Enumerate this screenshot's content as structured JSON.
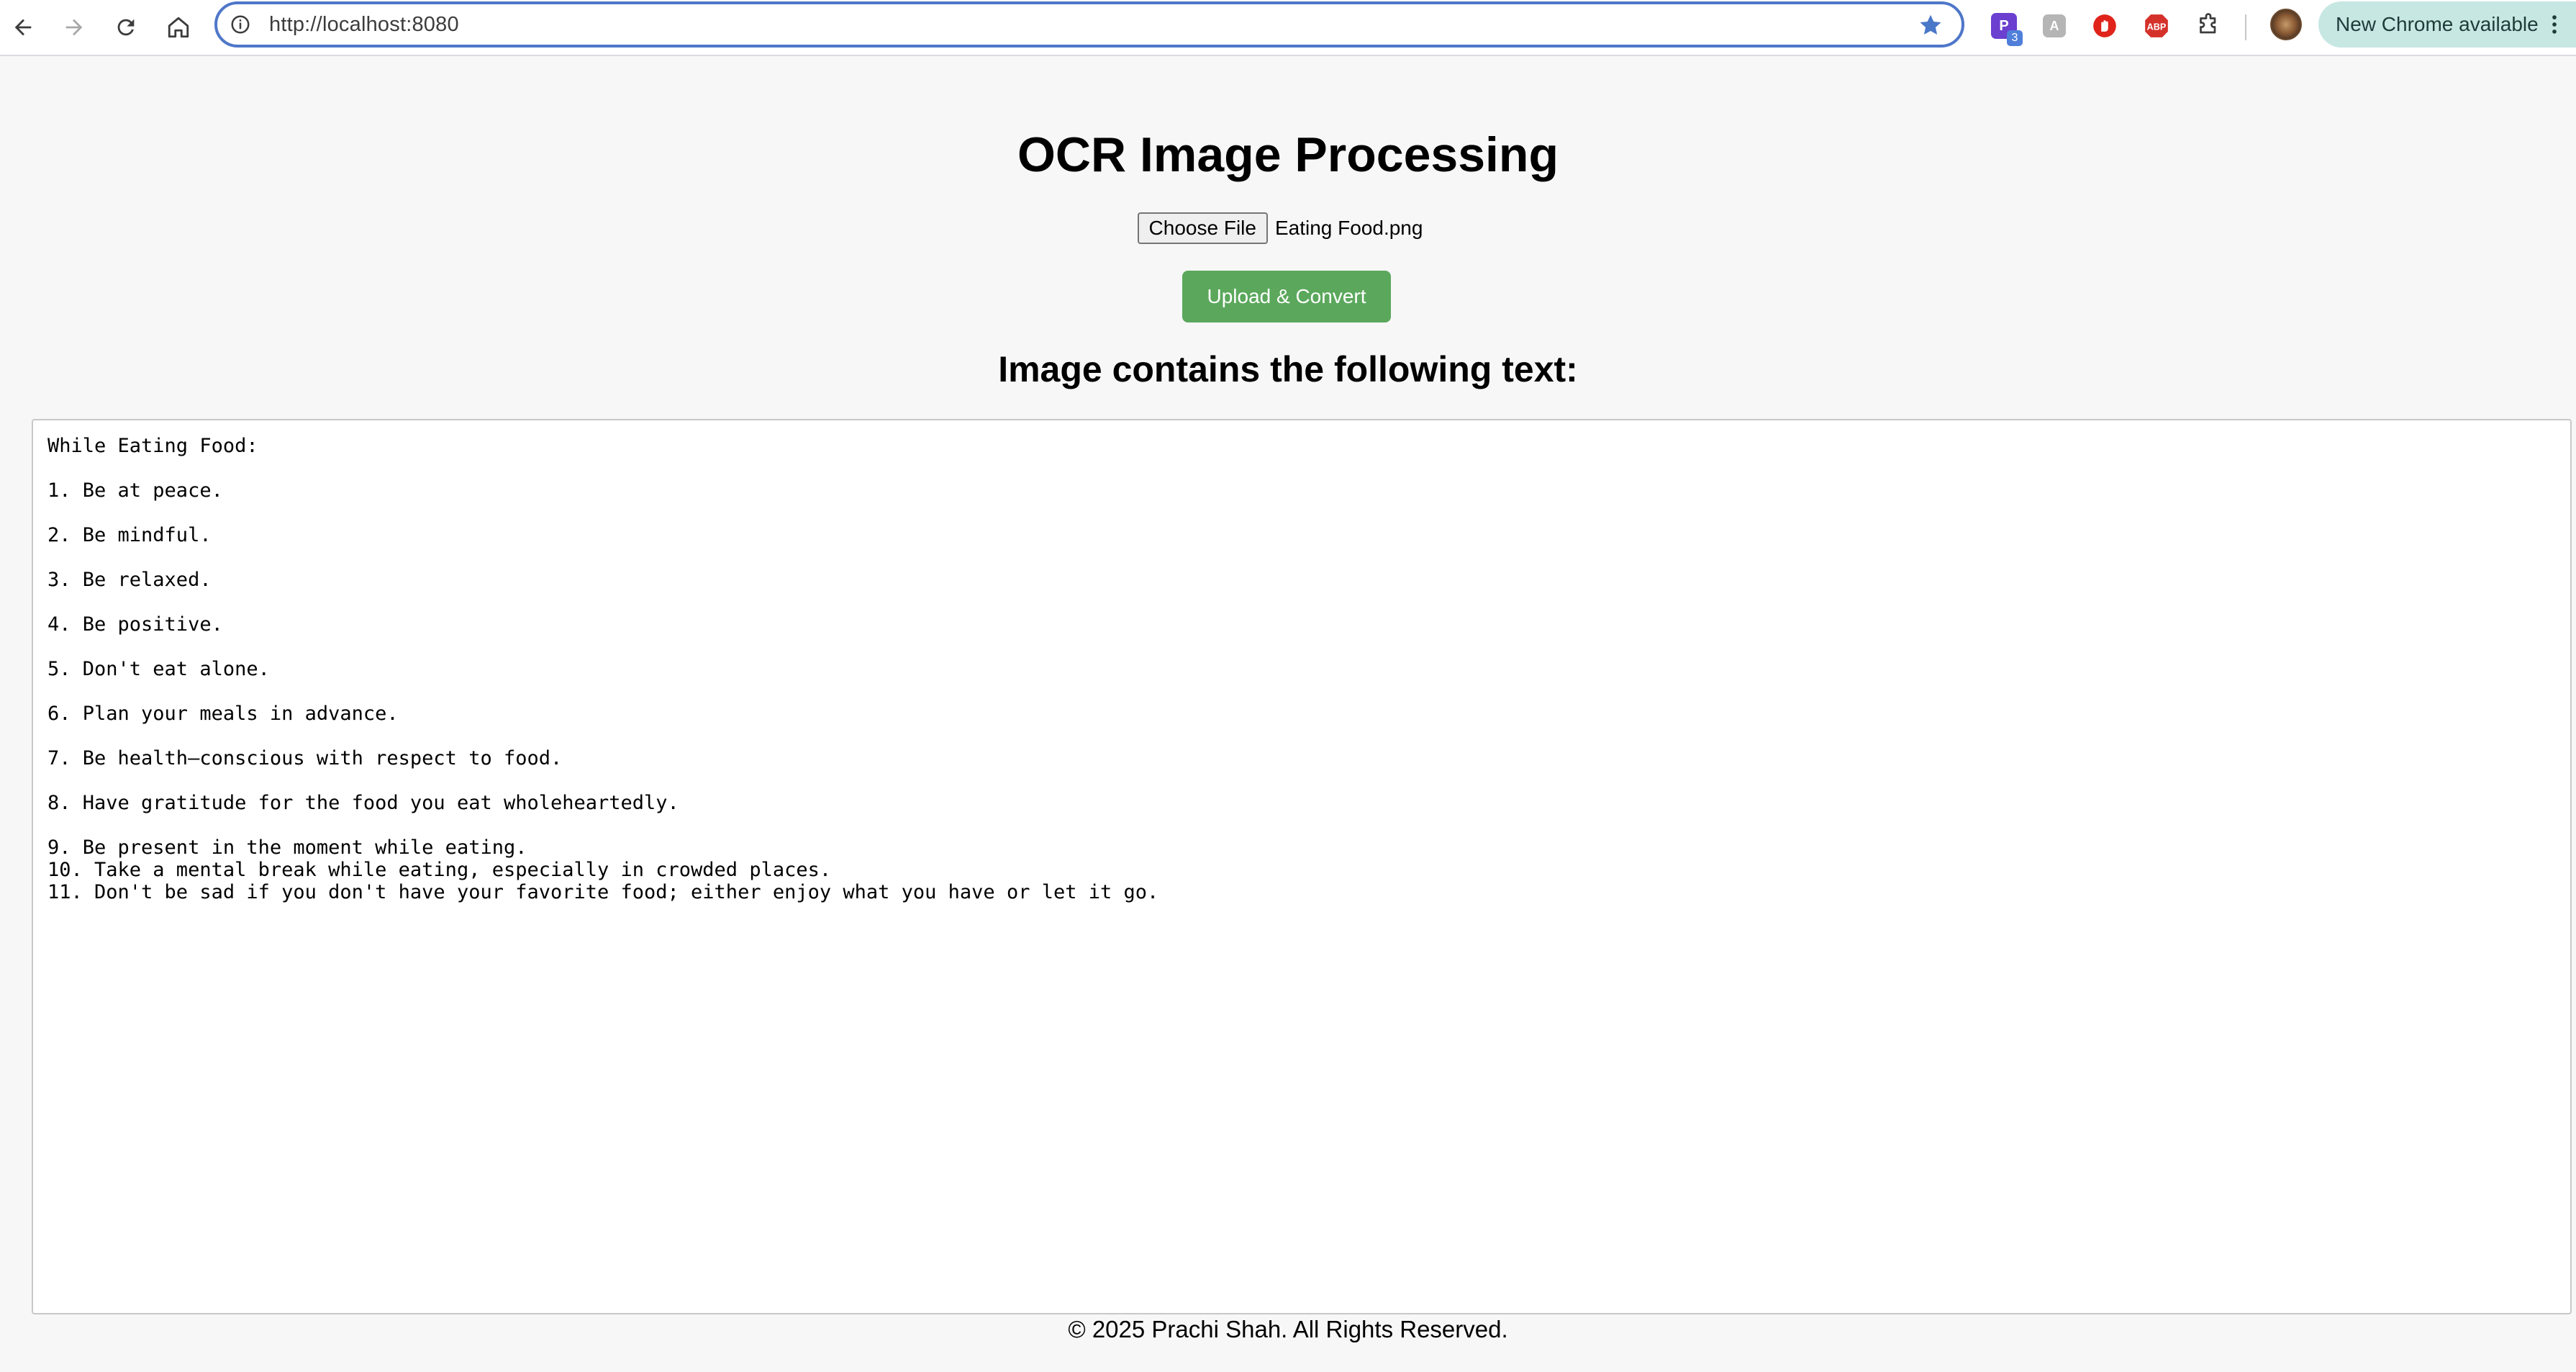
{
  "browser": {
    "url": "http://localhost:8080",
    "update_chip_label": "New Chrome available",
    "extensions": [
      {
        "icon": "purple-p-extension-icon",
        "badge": "3",
        "color": "#6b3fd0"
      },
      {
        "icon": "grey-extension-icon",
        "color": "#b5b5b5"
      },
      {
        "icon": "red-shield-extension-icon",
        "color": "#e0241b"
      },
      {
        "icon": "adblock-plus-icon",
        "text": "ABP",
        "color": "#d5312b"
      },
      {
        "icon": "puzzle-extensions-icon"
      }
    ]
  },
  "page": {
    "title": "OCR Image Processing",
    "file_input": {
      "button_label": "Choose File",
      "file_name": "Eating Food.png"
    },
    "upload_button_label": "Upload & Convert",
    "subtitle": "Image contains the following text:",
    "ocr_output": {
      "lines": [
        "While Eating Food:",
        "",
        "1. Be at peace.",
        "",
        "2. Be mindful.",
        "",
        "3. Be relaxed.",
        "",
        "4. Be positive.",
        "",
        "5. Don't eat alone.",
        "",
        "6. Plan your meals in advance.",
        "",
        "7. Be health—conscious with respect to food.",
        "",
        "8. Have gratitude for the food you eat wholeheartedly.",
        "",
        "9. Be present in the moment while eating.",
        "10. Take a mental break while eating, especially in crowded places.",
        "11. Don't be sad if you don't have your favorite food; either enjoy what you have or let it go."
      ]
    },
    "footer": "© 2025 Prachi Shah. All Rights Reserved."
  },
  "colors": {
    "upload_button": "#5ba85c",
    "page_background": "#f7f7f7",
    "omnibox_border": "#4f77c9",
    "update_chip": "#c7e7e3"
  }
}
